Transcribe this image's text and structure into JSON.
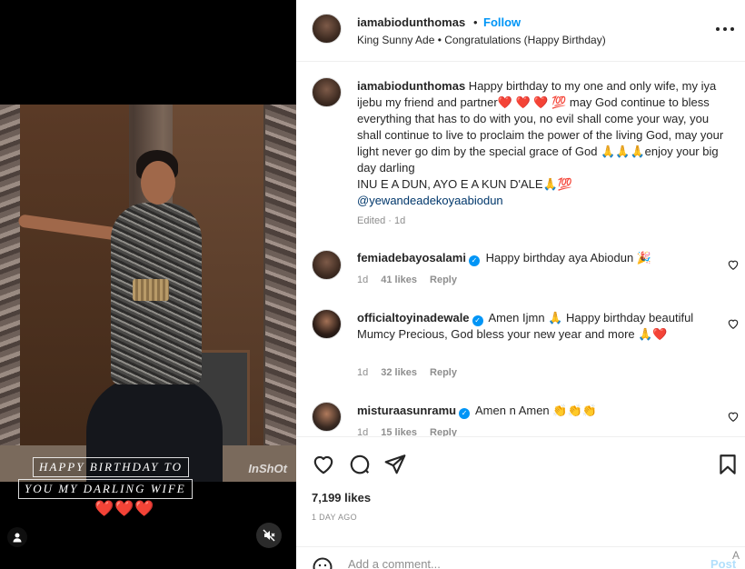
{
  "media": {
    "watermark": "InShOt",
    "caption_line1": "HAPPY BIRTHDAY TO",
    "caption_line2": "YOU MY DARLING WIFE",
    "hearts": "❤️❤️❤️"
  },
  "header": {
    "username": "iamabiodunthomas",
    "dot": "•",
    "follow_label": "Follow",
    "audio": "King Sunny Ade • Congratulations (Happy Birthday)"
  },
  "caption": {
    "username": "iamabiodunthomas",
    "text_1": " Happy birthday to my one and only wife, my iya ijebu my friend and partner",
    "emoji_1": "❤️ ❤️ ❤️ 💯",
    "text_2": " may God continue to bless everything that has to do with you, no evil shall come your way, you shall continue to live to proclaim the power of the living God, may your light never go dim by the special grace of God ",
    "emoji_2": "🙏🙏🙏",
    "text_3": "enjoy your big day darling",
    "text_4": "INU E A DUN, AYO E A KUN D'ALE",
    "emoji_3": "🙏💯",
    "mention": "@yewandeadekoyaabiodun",
    "meta": "Edited · 1d"
  },
  "comments": [
    {
      "username": "femiadebayosalami",
      "text": "Happy birthday aya Abiodun 🎉",
      "time": "1d",
      "likes": "41 likes",
      "reply": "Reply"
    },
    {
      "username": "officialtoyinadewale",
      "text": "Amen Ijmn 🙏  Happy birthday beautiful Mumcy Precious, God bless your new year and more 🙏❤️",
      "time": "1d",
      "likes": "32 likes",
      "reply": "Reply"
    },
    {
      "username": "misturaasunramu",
      "text": "Amen n Amen 👏👏👏",
      "time": "1d",
      "likes": "15 likes",
      "reply": "Reply"
    }
  ],
  "actions": {
    "likes": "7,199 likes",
    "date": "1 DAY AGO",
    "comment_placeholder": "Add a comment...",
    "post_label": "Post",
    "a_glyph": "A"
  },
  "colors": {
    "link_blue": "#0095f6",
    "mention_blue": "#00376b",
    "heart_red": "#e1131b",
    "muted": "#8e8e8e"
  },
  "icons": [
    "user-tag-icon",
    "muted-audio-icon",
    "more-icon",
    "verified-icon",
    "heart-icon",
    "comment-icon",
    "share-icon",
    "bookmark-icon",
    "emoji-icon"
  ]
}
